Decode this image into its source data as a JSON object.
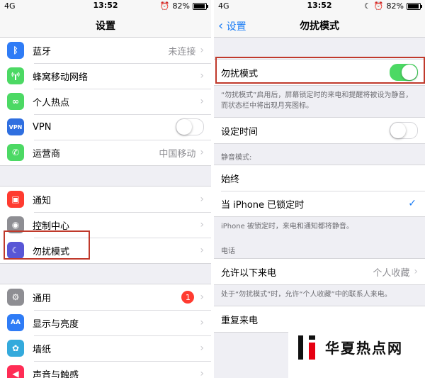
{
  "status": {
    "carrier": "4G",
    "time": "13:52",
    "battery": "82%",
    "battery_level": 0.82
  },
  "left": {
    "title": "设置",
    "group1": [
      {
        "label": "蓝牙",
        "value": "未连接",
        "icon": "bluetooth-icon",
        "color": "#2f7cf6",
        "glyph": "ᛒ"
      },
      {
        "label": "蜂窝移动网络",
        "value": "",
        "icon": "cellular-icon",
        "color": "#4cd964",
        "glyph": "📶"
      },
      {
        "label": "个人热点",
        "value": "",
        "icon": "hotspot-icon",
        "color": "#4cd964",
        "glyph": "∞"
      },
      {
        "label": "VPN",
        "value": "",
        "icon": "vpn-icon",
        "color": "#2f6fe0",
        "glyph": "VPN"
      },
      {
        "label": "运营商",
        "value": "中国移动",
        "icon": "phone-icon",
        "color": "#4cd964",
        "glyph": "✆"
      }
    ],
    "group2": [
      {
        "label": "通知",
        "icon": "notification-icon",
        "color": "#ff3b30",
        "glyph": "▣"
      },
      {
        "label": "控制中心",
        "icon": "control-center-icon",
        "color": "#8e8e93",
        "glyph": "◉"
      },
      {
        "label": "勿扰模式",
        "icon": "moon-icon",
        "color": "#5856d6",
        "glyph": "☾"
      }
    ],
    "group3": [
      {
        "label": "通用",
        "badge": "1",
        "icon": "gear-icon",
        "color": "#8e8e93",
        "glyph": "⚙"
      },
      {
        "label": "显示与亮度",
        "icon": "display-icon",
        "color": "#2f7cf6",
        "glyph": "AA"
      },
      {
        "label": "墙纸",
        "icon": "wallpaper-icon",
        "color": "#34aadc",
        "glyph": "✿"
      },
      {
        "label": "声音与触感",
        "icon": "sound-icon",
        "color": "#ff2d55",
        "glyph": "◀"
      }
    ]
  },
  "right": {
    "back": "设置",
    "title": "勿扰模式",
    "dnd_label": "勿扰模式",
    "dnd_note": "“勿扰模式”启用后，屏幕锁定时的来电和提醒将被设为静音，而状态栏中将出现月亮图标。",
    "schedule_label": "设定时间",
    "silence_header": "静音模式:",
    "always": "始终",
    "locked": "当 iPhone 已锁定时",
    "locked_note": "iPhone 被锁定时，来电和通知都将静音。",
    "phone_header": "电话",
    "allow_label": "允许以下来电",
    "allow_value": "个人收藏",
    "allow_note": "处于“勿扰模式”时，允许“个人收藏”中的联系人来电。",
    "repeat_label": "重复来电"
  },
  "watermark": {
    "text": "华夏热点网"
  }
}
